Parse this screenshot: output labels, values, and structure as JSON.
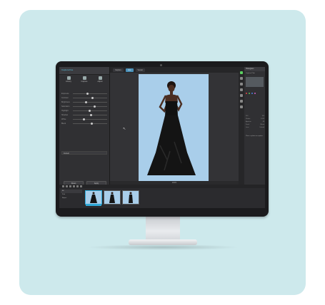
{
  "app": {
    "title": "CaptureOne",
    "left_tabs": [
      "Library",
      "Capture",
      "Adjust"
    ],
    "sliders": [
      "Exposure",
      "Contrast",
      "Brightness",
      "Saturation",
      "Highlight",
      "Shadow",
      "White",
      "Black"
    ],
    "preset_select": "Default",
    "buttons": [
      "Reset",
      "Apply"
    ]
  },
  "viewer": {
    "tabs": [
      "Capture",
      "Live",
      "Viewer"
    ],
    "active_tab": 1,
    "zoom_label": "100%"
  },
  "right_panel": {
    "header": "Histogram",
    "info_title": "Capture Pilot",
    "meta": [
      [
        "ISO",
        "100"
      ],
      [
        "Shutter",
        "1/125"
      ],
      [
        "Aperture",
        "f/8"
      ],
      [
        "Focal",
        "85mm"
      ],
      [
        "Lens",
        "Default"
      ]
    ],
    "note": "Place a photo to capture"
  },
  "filmstrip": {
    "side_items": [
      "All",
      "Pick",
      "Reject"
    ],
    "thumb_count": 3,
    "selected_index": 0
  },
  "colors": {
    "card": "#cde9ec",
    "accent": "#2fa9d8",
    "backdrop": "#a9ceea"
  }
}
